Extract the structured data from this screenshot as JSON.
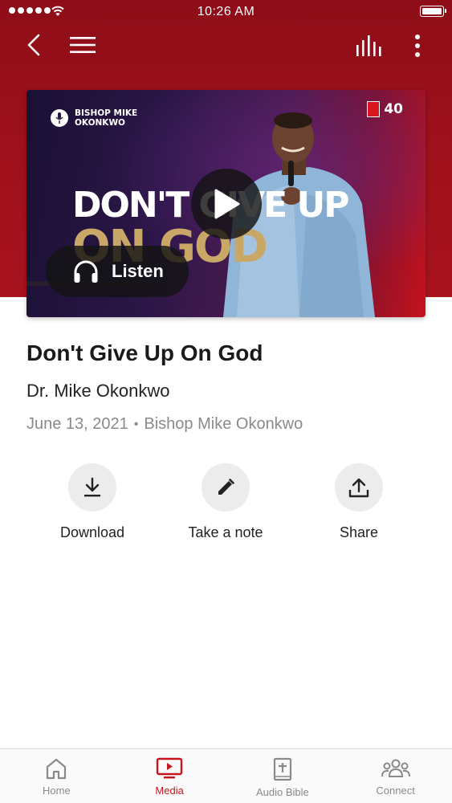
{
  "status_bar": {
    "time": "10:26 AM"
  },
  "media": {
    "brand_text": "BISHOP MIKE OKONKWO",
    "anniversary_text": "40",
    "headline_line1": "DON'T GIVE UP",
    "headline_line2": "ON GOD",
    "listen_label": "Listen"
  },
  "sermon": {
    "title": "Don't Give Up On God",
    "speaker": "Dr. Mike Okonkwo",
    "date": "June 13, 2021",
    "separator": "•",
    "channel": "Bishop Mike Okonkwo"
  },
  "actions": {
    "download": "Download",
    "note": "Take a note",
    "share": "Share"
  },
  "tabs": [
    {
      "label": "Home",
      "icon": "home-icon"
    },
    {
      "label": "Media",
      "icon": "tv-play-icon",
      "active": true
    },
    {
      "label": "Audio Bible",
      "icon": "bible-icon"
    },
    {
      "label": "Connect",
      "icon": "group-icon"
    }
  ],
  "colors": {
    "brand_red": "#a0111c",
    "active_tab": "#c8141e",
    "headline_gold": "#c9a867"
  }
}
